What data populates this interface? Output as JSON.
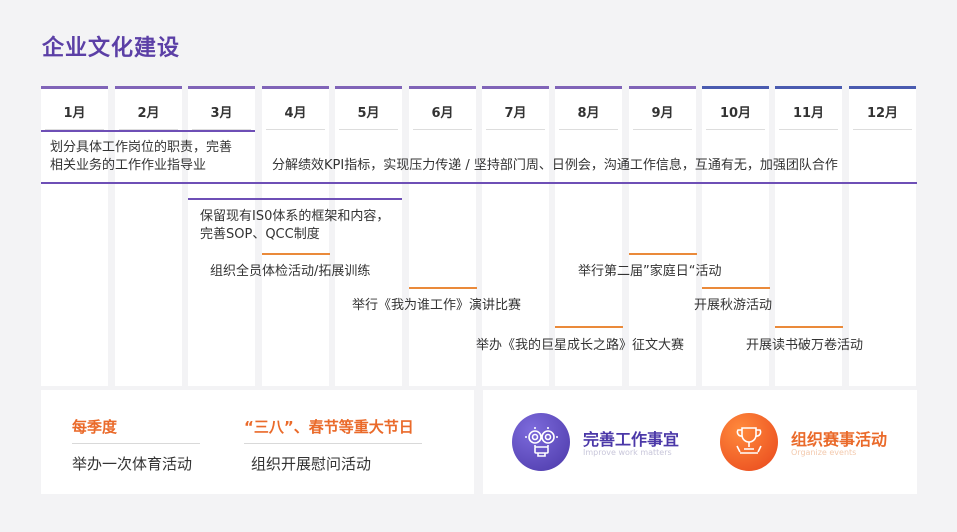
{
  "title": "企业文化建设",
  "months": [
    "1月",
    "2月",
    "3月",
    "4月",
    "5月",
    "6月",
    "7月",
    "8月",
    "9月",
    "10月",
    "11月",
    "12月"
  ],
  "items": {
    "r1": "划分具体工作岗位的职责，完善",
    "r1b": "相关业务的工作作业指导业",
    "kpi": "分解绩效KPI指标，实现压力传递 / 坚持部门周、日例会，沟通工作信息，互通有无，加强团队合作",
    "iso1": "保留现有IS0体系的框架和内容，",
    "iso2": "完善SOP、QCC制度",
    "health": "组织全员体检活动/拓展训练",
    "speech": "举行《我为谁工作》演讲比赛",
    "essay": "举办《我的巨星成长之路》征文大赛",
    "family": "举行第二届”家庭日“活动",
    "autumn": "开展秋游活动",
    "reading": "开展读书破万卷活动"
  },
  "bottom_left": {
    "quarterly_title": "每季度",
    "quarterly_text": "举办一次体育活动",
    "holiday_title": "“三八”、春节等重大节日",
    "holiday_text": "组织开展慰问活动"
  },
  "bottom_right": {
    "improve_title": "完善工作事宜",
    "improve_sub": "Improve work matters",
    "events_title": "组织赛事活动",
    "events_sub": "Organize events"
  },
  "colors": {
    "accent_purple": "#5b3fa6",
    "accent_orange": "#ea6a2a",
    "orange_line": "#ea8a3a"
  }
}
